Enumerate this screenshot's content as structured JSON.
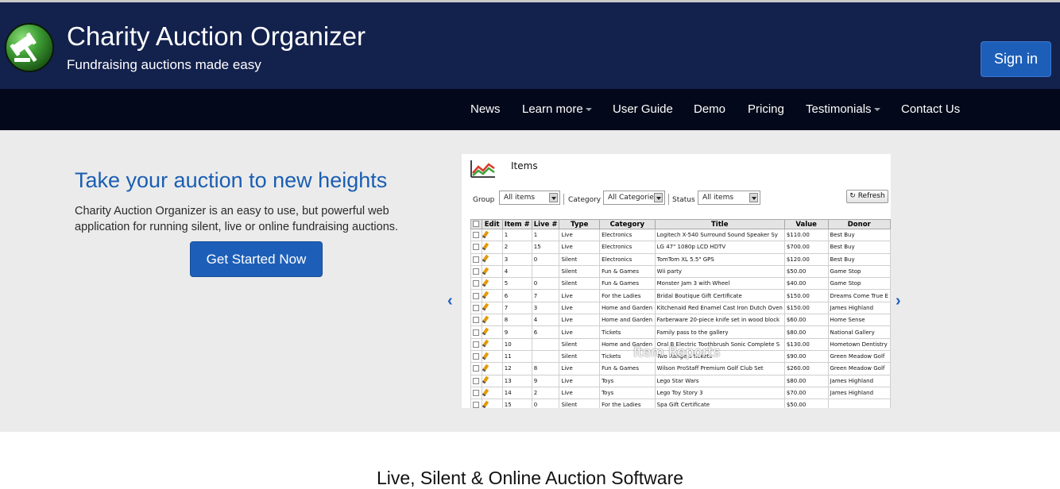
{
  "site": {
    "title": "Charity Auction Organizer",
    "tagline": "Fundraising auctions made easy",
    "signin_label": "Sign in"
  },
  "nav": {
    "items": [
      {
        "label": "News",
        "has_dropdown": false
      },
      {
        "label": "Learn more",
        "has_dropdown": true
      },
      {
        "label": "User Guide",
        "has_dropdown": false
      },
      {
        "label": "Demo",
        "has_dropdown": false
      },
      {
        "label": "Pricing",
        "has_dropdown": false
      },
      {
        "label": "Testimonials",
        "has_dropdown": true
      },
      {
        "label": "Contact Us",
        "has_dropdown": false
      }
    ]
  },
  "hero": {
    "title": "Take your auction to new heights",
    "text": "Charity Auction Organizer is an easy to use, but powerful web application for running silent, live or online fundraising auctions.",
    "cta_label": "Get Started Now",
    "prev_icon": "chevron-left-icon",
    "next_icon": "chevron-right-icon",
    "prev_glyph": "‹",
    "next_glyph": "›"
  },
  "carousel": {
    "caption": "Item Reports",
    "screen_title": "Items",
    "filters": {
      "group_label": "Group",
      "group_value": "All items",
      "category_label": "Category",
      "category_value": "All Categorie",
      "status_label": "Status",
      "status_value": "All items",
      "refresh_label": "Refresh"
    },
    "columns": [
      "",
      "Edit",
      "Item #",
      "Live #",
      "Type",
      "Category",
      "Title",
      "Value",
      "Donor"
    ],
    "rows": [
      [
        "1",
        "1",
        "Live",
        "Electronics",
        "Logitech X-540 Surround Sound Speaker Sy",
        "$110.00",
        "Best Buy"
      ],
      [
        "2",
        "15",
        "Live",
        "Electronics",
        "LG 47\" 1080p LCD HDTV",
        "$700.00",
        "Best Buy"
      ],
      [
        "3",
        "0",
        "Silent",
        "Electronics",
        "TomTom XL 5.5\" GPS",
        "$120.00",
        "Best Buy"
      ],
      [
        "4",
        "",
        "Silent",
        "Fun & Games",
        "Wii party",
        "$50.00",
        "Game Stop"
      ],
      [
        "5",
        "0",
        "Silent",
        "Fun & Games",
        "Monster Jam 3 with Wheel",
        "$40.00",
        "Game Stop"
      ],
      [
        "6",
        "7",
        "Live",
        "For the Ladies",
        "Bridal Boutique Gift Certificate",
        "$150.00",
        "Dreams Come True E"
      ],
      [
        "7",
        "3",
        "Live",
        "Home and Garden",
        "Kitchenaid Red Enamel Cast Iron Dutch Oven",
        "$150.00",
        "James Highland"
      ],
      [
        "8",
        "4",
        "Live",
        "Home and Garden",
        "Farberware 20-piece knife set in wood block",
        "$60.00",
        "Home Sense"
      ],
      [
        "9",
        "6",
        "Live",
        "Tickets",
        "Family pass to the gallery",
        "$80.00",
        "National Gallery"
      ],
      [
        "10",
        "",
        "Silent",
        "Home and Garden",
        "Oral B Electric Toothbrush Sonic Complete S",
        "$130.00",
        "Hometown Dentistry"
      ],
      [
        "11",
        "",
        "Silent",
        "Tickets",
        "Two Rangers tickets",
        "$90.00",
        "Green Meadow Golf"
      ],
      [
        "12",
        "8",
        "Live",
        "Fun & Games",
        "Wilson ProStaff Premium Golf Club Set",
        "$260.00",
        "Green Meadow Golf"
      ],
      [
        "13",
        "9",
        "Live",
        "Toys",
        "Lego Star Wars",
        "$80.00",
        "James Highland"
      ],
      [
        "14",
        "2",
        "Live",
        "Toys",
        "Lego Toy Story 3",
        "$70.00",
        "James Highland"
      ],
      [
        "15",
        "0",
        "Silent",
        "For the Ladies",
        "Spa Gift Certificate",
        "$50.00",
        ""
      ]
    ]
  },
  "section": {
    "title": "Live, Silent & Online Auction Software"
  },
  "colors": {
    "header_bg": "#13214d",
    "nav_bg": "#03091a",
    "accent": "#1d5fb8",
    "hero_bg": "#ebebeb",
    "hero_title": "#1a5eb2"
  }
}
